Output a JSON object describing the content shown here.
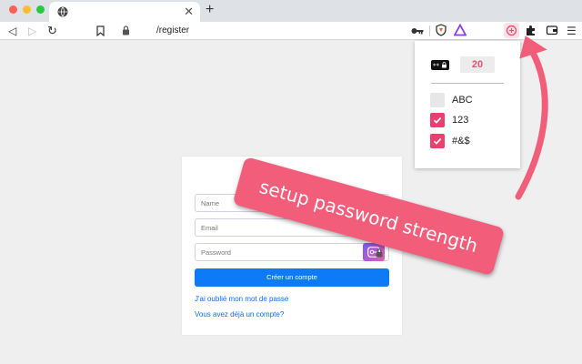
{
  "browser": {
    "url": "/register"
  },
  "form": {
    "name_placeholder": "Name",
    "email_placeholder": "Email",
    "password_placeholder": "Password",
    "submit_label": "Créer un compte",
    "forgot_link": "J'ai oublié mon mot de passe",
    "login_link": "Vous avez déjà un compte?"
  },
  "popup": {
    "length": "20",
    "options": [
      {
        "label": "ABC",
        "checked": false
      },
      {
        "label": "123",
        "checked": true
      },
      {
        "label": "#&$",
        "checked": true
      }
    ]
  },
  "annotation": {
    "text": "setup password strength"
  },
  "colors": {
    "accent": "#f25d7a",
    "checkbox": "#ec3f6d",
    "primary_button": "#0d7bf7"
  }
}
